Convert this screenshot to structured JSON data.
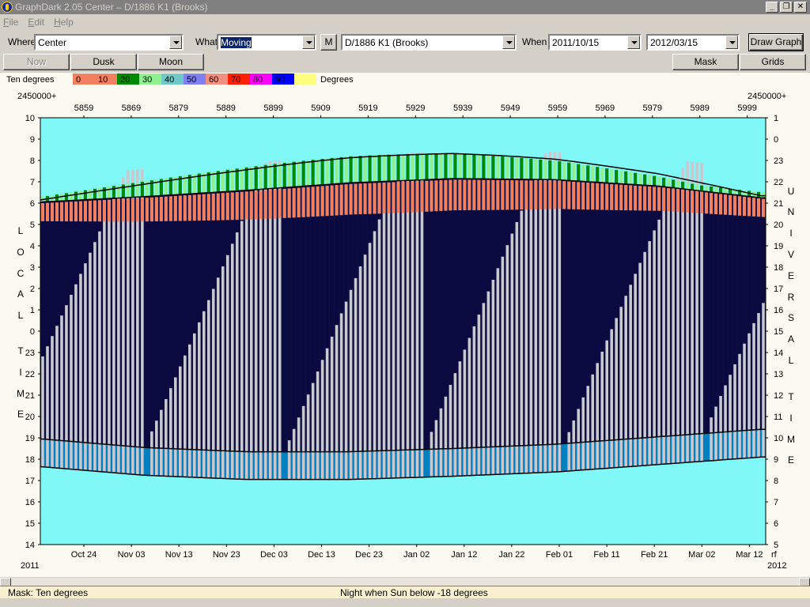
{
  "window": {
    "title": "GraphDark 2.05  Center  –  D/1886 K1 (Brooks)",
    "minimize": "_",
    "restore": "❐",
    "close": "✕"
  },
  "menu": {
    "items": [
      {
        "label": "File",
        "accel": "F"
      },
      {
        "label": "Edit",
        "accel": "E"
      },
      {
        "label": "Help",
        "accel": "H"
      }
    ]
  },
  "toolbar": {
    "where_label": "Where",
    "where_value": "Center",
    "what_label": "What",
    "what_value": "Moving",
    "m_button": "M",
    "object_value": "D/1886 K1 (Brooks)",
    "when_label": "When",
    "start_date": "2011/10/15",
    "end_date": "2012/03/15",
    "draw_button": "Draw Graph"
  },
  "buttons": {
    "now": "Now",
    "dusk": "Dusk",
    "moon": "Moon",
    "mask": "Mask",
    "grids": "Grids"
  },
  "legend": {
    "title": "Ten degrees",
    "unit": "Degrees",
    "colors": [
      "#f08060",
      "#f08060",
      "#008800",
      "#90f090",
      "#70c8c8",
      "#8080f0",
      "#f09080",
      "#ff2000",
      "#ff0000",
      "#ff00ff",
      "#0000ff",
      "#ffff80"
    ],
    "labels": [
      "0",
      "10",
      "20",
      "30",
      "40",
      "50",
      "60",
      "70",
      "80",
      "90",
      ""
    ]
  },
  "chart_data": {
    "type": "heatmap",
    "title": "",
    "jd_prefix_left": "2450000+",
    "jd_prefix_right": "2450000+",
    "jd_ticks": [
      "5859",
      "5869",
      "5879",
      "5889",
      "5899",
      "5909",
      "5919",
      "5929",
      "5939",
      "5949",
      "5959",
      "5969",
      "5979",
      "5989",
      "5999"
    ],
    "date_ticks": [
      "Oct 24",
      "Nov 03",
      "Nov 13",
      "Nov 23",
      "Dec 03",
      "Dec 13",
      "Dec 23",
      "Jan 02",
      "Jan 12",
      "Jan 22",
      "Feb 01",
      "Feb 11",
      "Feb 21",
      "Mar 02",
      "Mar 12"
    ],
    "year_left": "2011",
    "year_right": "2012",
    "corner_right": "rf",
    "local_time_ticks": [
      "10",
      "9",
      "8",
      "7",
      "6",
      "5",
      "4",
      "3",
      "2",
      "1",
      "0",
      "23",
      "22",
      "21",
      "20",
      "19",
      "18",
      "17",
      "16",
      "15",
      "14"
    ],
    "ut_ticks": [
      "1",
      "0",
      "23",
      "22",
      "21",
      "20",
      "19",
      "18",
      "17",
      "16",
      "15",
      "14",
      "13",
      "12",
      "11",
      "10",
      "9",
      "8",
      "7",
      "6",
      "5"
    ],
    "left_axis_label": "LOCAL TIME",
    "right_axis_label": "UNIVERSAL TIME",
    "day_count": 153,
    "night_start_hour": [
      18.95,
      18.55,
      18.35,
      18.35,
      18.5,
      18.7,
      19.05,
      19.4
    ],
    "night_end_hour": [
      6.05,
      6.3,
      6.6,
      6.95,
      7.15,
      7.1,
      6.8,
      6.25
    ],
    "twilight_band_color": "#0080c0",
    "night_color": "#0a0a40",
    "day_color": "#80f8f8",
    "moonlight_color": "#c8c8d0",
    "object_alt_colors": {
      "low": "#f08060",
      "mid": "#008800",
      "high": "#90f090"
    }
  },
  "status": {
    "mask": "Mask:  Ten degrees",
    "night": "Night when Sun below -18 degrees"
  }
}
